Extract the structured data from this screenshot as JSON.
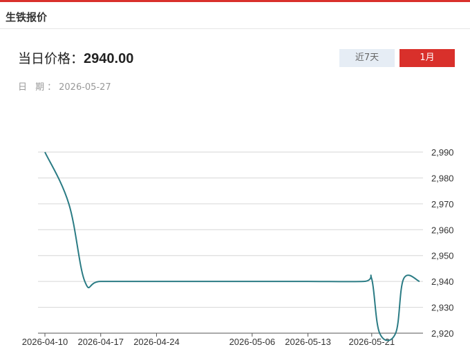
{
  "header": {
    "title": "生铁报价"
  },
  "price": {
    "label": "当日价格：",
    "value": "2940.00"
  },
  "date": {
    "label": "日  期：",
    "value": "2026-05-27"
  },
  "range_buttons": {
    "week": "近7天",
    "month": "1月",
    "active": "month"
  },
  "colors": {
    "accent": "#d9302b",
    "line": "#2a7b84",
    "inactive_button": "#e6edf5"
  },
  "chart_data": {
    "type": "line",
    "title": "",
    "xlabel": "",
    "ylabel": "",
    "x_ticks": [
      "2026-04-10",
      "2026-04-17",
      "2026-04-24",
      "2026-05-06",
      "2026-05-13",
      "2026-05-21"
    ],
    "y_ticks": [
      "2,920",
      "2,930",
      "2,940",
      "2,950",
      "2,960",
      "2,970",
      "2,980",
      "2,990"
    ],
    "ylim": [
      2920,
      2990
    ],
    "grid": true,
    "y_axis_position": "right",
    "series": [
      {
        "points": [
          {
            "x": "2026-04-10",
            "y": 2990
          },
          {
            "x": "2026-04-13",
            "y": 2970
          },
          {
            "x": "2026-04-15",
            "y": 2940
          },
          {
            "x": "2026-04-17",
            "y": 2940
          },
          {
            "x": "2026-04-24",
            "y": 2940
          },
          {
            "x": "2026-05-06",
            "y": 2940
          },
          {
            "x": "2026-05-13",
            "y": 2940
          },
          {
            "x": "2026-05-20",
            "y": 2940
          },
          {
            "x": "2026-05-21",
            "y": 2941
          },
          {
            "x": "2026-05-22",
            "y": 2920
          },
          {
            "x": "2026-05-24",
            "y": 2920
          },
          {
            "x": "2026-05-25",
            "y": 2941
          },
          {
            "x": "2026-05-27",
            "y": 2940
          }
        ]
      }
    ]
  }
}
